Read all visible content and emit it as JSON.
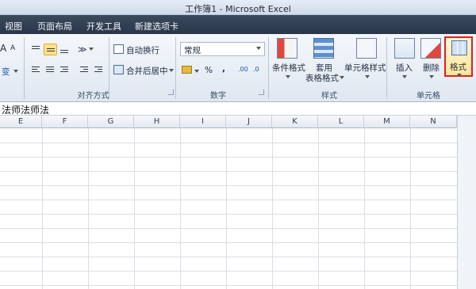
{
  "window": {
    "title": "工作簿1 - Microsoft Excel"
  },
  "tabs": [
    {
      "label": "视图"
    },
    {
      "label": "页面布局"
    },
    {
      "label": "开发工具"
    },
    {
      "label": "新建选项卡"
    }
  ],
  "ribbon": {
    "font_group": {
      "grow_label": "A",
      "shrink_label": "A",
      "phonetic_label": "变"
    },
    "alignment": {
      "label": "对齐方式",
      "wrap_text": "自动换行",
      "merge_center": "合并后居中"
    },
    "number": {
      "label": "数字",
      "format_value": "常规",
      "percent": "%",
      "comma": ",",
      "increase_decimal": ".00",
      "decrease_decimal": ".0"
    },
    "styles": {
      "label": "样式",
      "conditional_formatting": "条件格式",
      "format_as_table_line1": "套用",
      "format_as_table_line2": "表格格式",
      "cell_styles": "单元格样式"
    },
    "cells": {
      "label": "单元格",
      "insert": "插入",
      "delete": "删除",
      "format": "格式"
    },
    "colors": {
      "highlight_border": "#e02020",
      "active_button": "#ffe28a"
    }
  },
  "formula_bar": {
    "content": "法师法师法"
  },
  "grid": {
    "columns": [
      "E",
      "F",
      "G",
      "H",
      "I",
      "J",
      "K",
      "L",
      "M",
      "N"
    ]
  }
}
